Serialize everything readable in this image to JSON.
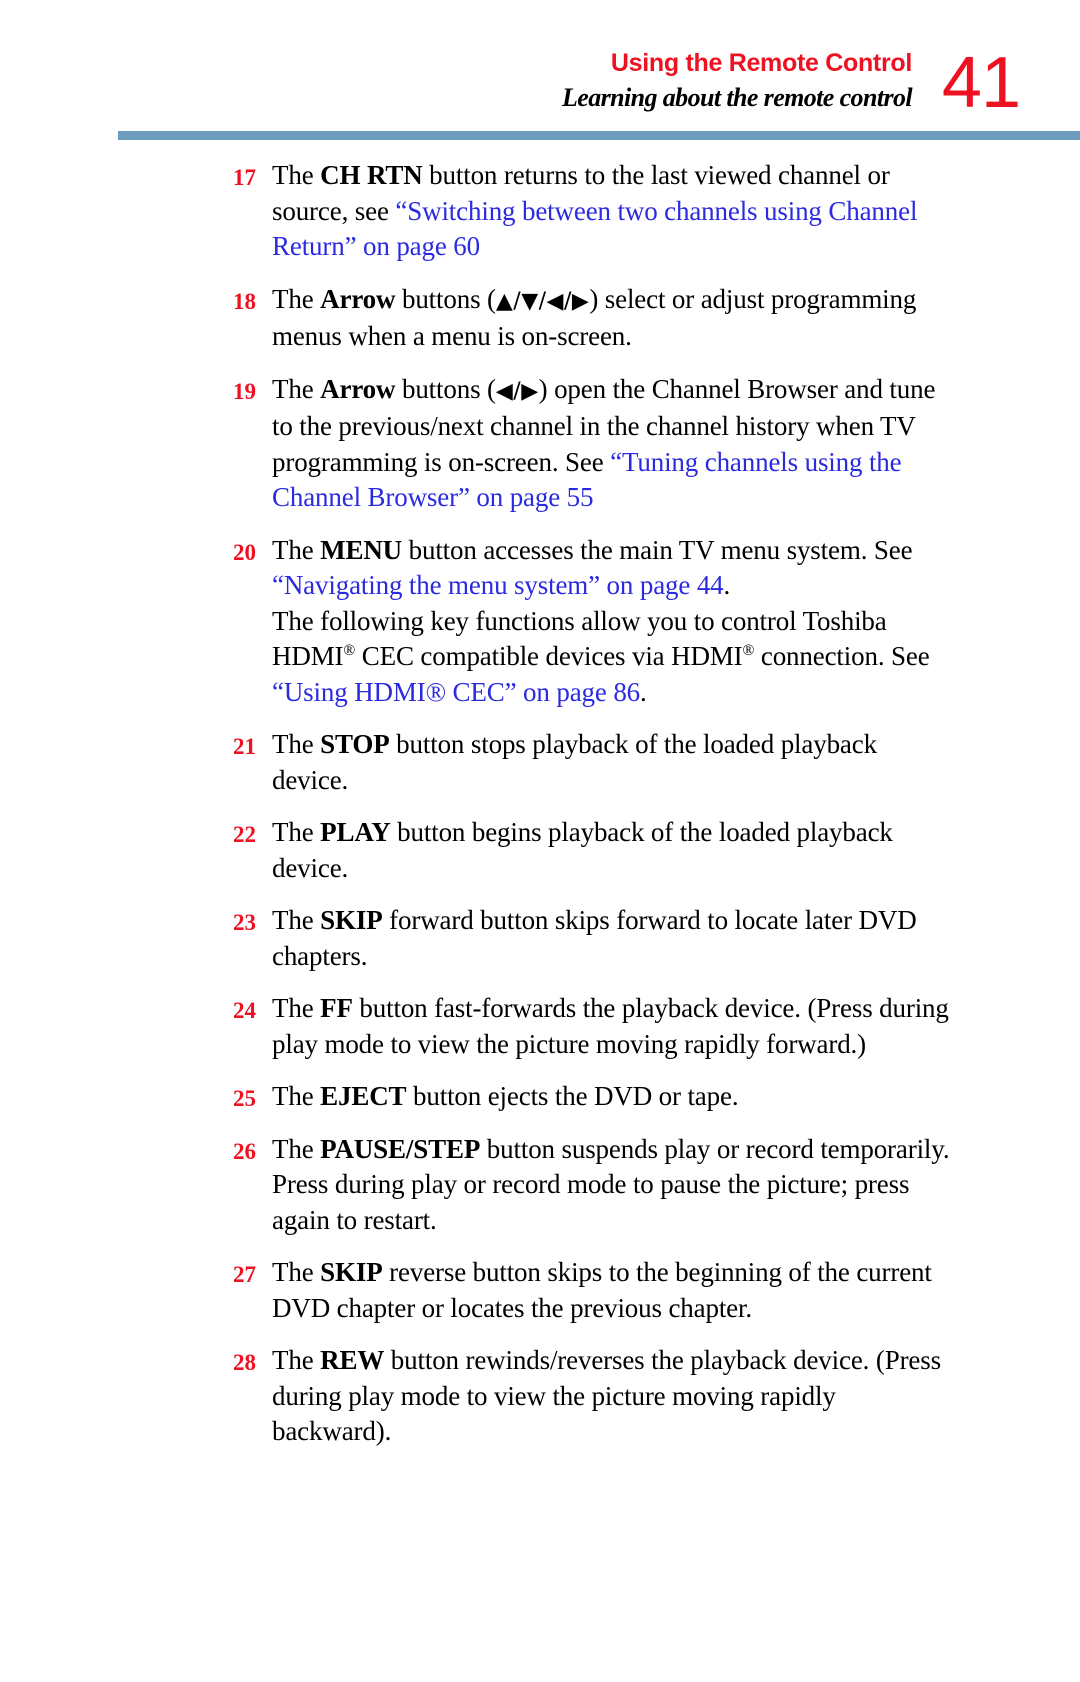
{
  "header": {
    "title": "Using the Remote Control",
    "subtitle": "Learning about the remote control",
    "page_number": "41",
    "accent_red": "#ee1122",
    "rule_color": "#6d9dbd",
    "link_blue": "#2a2ae0"
  },
  "items": [
    {
      "number": "17",
      "segments": [
        {
          "text": "The ",
          "style": "normal"
        },
        {
          "text": "CH RTN",
          "style": "bold"
        },
        {
          "text": " button returns to the last viewed channel or source, see ",
          "style": "normal"
        },
        {
          "text": "“Switching between two channels using Channel Return” on page 60",
          "style": "link"
        }
      ],
      "plain": "17 The CH RTN button returns to the last viewed channel or source, see “Switching between two channels using Channel Return” on page 60"
    },
    {
      "number": "18",
      "segments": [
        {
          "text": "The ",
          "style": "normal"
        },
        {
          "text": "Arrow",
          "style": "bold"
        },
        {
          "text": " buttons (",
          "style": "normal"
        },
        {
          "text": "▲/▼/◀/▶",
          "style": "arrows"
        },
        {
          "text": ") select or adjust programming menus when a menu is on-screen.",
          "style": "normal"
        }
      ],
      "plain": "18 The Arrow buttons (▲/▼/◀/▶) select or adjust programming menus when a menu is on-screen."
    },
    {
      "number": "19",
      "segments": [
        {
          "text": "The ",
          "style": "normal"
        },
        {
          "text": "Arrow",
          "style": "bold"
        },
        {
          "text": " buttons (",
          "style": "normal"
        },
        {
          "text": "◀/▶",
          "style": "arrows"
        },
        {
          "text": ") open the Channel Browser and tune to the previous/next channel in the channel history when TV programming is on-screen. See ",
          "style": "normal"
        },
        {
          "text": "“Tuning channels using the Channel Browser” on page 55",
          "style": "link"
        }
      ],
      "plain": "19 The Arrow buttons (◀/▶) open the Channel Browser and tune to the previous/next channel in the channel history when TV programming is on-screen. See “Tuning channels using the Channel Browser” on page 55"
    },
    {
      "number": "20",
      "segments": [
        {
          "text": "The ",
          "style": "normal"
        },
        {
          "text": "MENU",
          "style": "bold"
        },
        {
          "text": " button accesses the main TV menu system. See ",
          "style": "normal"
        },
        {
          "text": "“Navigating the menu system” on page 44",
          "style": "link"
        },
        {
          "text": ".",
          "style": "normal"
        },
        {
          "text": "\n",
          "style": "break"
        },
        {
          "text": "The following key functions allow you to control Toshiba HDMI",
          "style": "normal"
        },
        {
          "text": "®",
          "style": "superscript"
        },
        {
          "text": " CEC compatible devices via HDMI",
          "style": "normal"
        },
        {
          "text": "®",
          "style": "superscript"
        },
        {
          "text": " connection. See ",
          "style": "normal"
        },
        {
          "text": "“Using HDMI® CEC” on page 86",
          "style": "link"
        },
        {
          "text": ".",
          "style": "normal"
        }
      ],
      "plain": "20 The MENU button accesses the main TV menu system. See “Navigating the menu system” on page 44. The following key functions allow you to control Toshiba HDMI® CEC compatible devices via HDMI® connection. See “Using HDMI® CEC” on page 86."
    },
    {
      "number": "21",
      "segments": [
        {
          "text": "The ",
          "style": "normal"
        },
        {
          "text": "STOP",
          "style": "bold"
        },
        {
          "text": " button stops playback of the loaded playback device.",
          "style": "normal"
        }
      ],
      "plain": "21 The STOP button stops playback of the loaded playback device."
    },
    {
      "number": "22",
      "segments": [
        {
          "text": "The ",
          "style": "normal"
        },
        {
          "text": "PLAY",
          "style": "bold"
        },
        {
          "text": " button begins playback of the loaded playback device.",
          "style": "normal"
        }
      ],
      "plain": "22 The PLAY button begins playback of the loaded playback device."
    },
    {
      "number": "23",
      "segments": [
        {
          "text": "The ",
          "style": "normal"
        },
        {
          "text": "SKIP",
          "style": "bold"
        },
        {
          "text": " forward button skips forward to locate later DVD chapters.",
          "style": "normal"
        }
      ],
      "plain": "23 The SKIP forward button skips forward to locate later DVD chapters."
    },
    {
      "number": "24",
      "segments": [
        {
          "text": "The ",
          "style": "normal"
        },
        {
          "text": "FF",
          "style": "bold"
        },
        {
          "text": " button fast-forwards the playback device. (Press during play mode to view the picture moving rapidly forward.)",
          "style": "normal"
        }
      ],
      "plain": "24 The FF button fast-forwards the playback device. (Press during play mode to view the picture moving rapidly forward.)"
    },
    {
      "number": "25",
      "segments": [
        {
          "text": "The ",
          "style": "normal"
        },
        {
          "text": "EJECT",
          "style": "bold"
        },
        {
          "text": " button ejects the DVD or tape.",
          "style": "normal"
        }
      ],
      "plain": "25 The EJECT button ejects the DVD or tape."
    },
    {
      "number": "26",
      "segments": [
        {
          "text": "The ",
          "style": "normal"
        },
        {
          "text": "PAUSE/STEP",
          "style": "bold"
        },
        {
          "text": " button suspends play or record temporarily. Press during play or record mode to pause the picture; press again to restart.",
          "style": "normal"
        }
      ],
      "plain": "26 The PAUSE/STEP button suspends play or record temporarily. Press during play or record mode to pause the picture; press again to restart."
    },
    {
      "number": "27",
      "segments": [
        {
          "text": "The ",
          "style": "normal"
        },
        {
          "text": "SKIP",
          "style": "bold"
        },
        {
          "text": " reverse button skips to the beginning of the current DVD chapter or locates the previous chapter.",
          "style": "normal"
        }
      ],
      "plain": "27 The SKIP reverse button skips to the beginning of the current DVD chapter or locates the previous chapter."
    },
    {
      "number": "28",
      "segments": [
        {
          "text": "The ",
          "style": "normal"
        },
        {
          "text": "REW",
          "style": "bold"
        },
        {
          "text": " button rewinds/reverses the playback device. (Press during play mode to view the picture moving rapidly backward).",
          "style": "normal"
        }
      ],
      "plain": "28 The REW button rewinds/reverses the playback device. (Press during play mode to view the picture moving rapidly backward)."
    }
  ]
}
